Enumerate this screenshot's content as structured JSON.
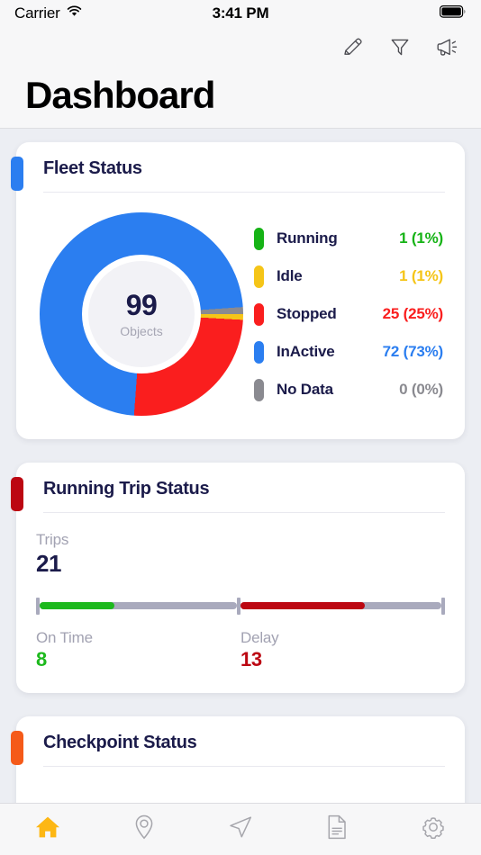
{
  "status_bar": {
    "carrier": "Carrier",
    "time": "3:41 PM",
    "wifi_icon": "wifi-icon",
    "battery_icon": "battery-full-icon"
  },
  "header": {
    "title": "Dashboard",
    "actions": [
      {
        "name": "edit-button",
        "icon": "pencil-icon"
      },
      {
        "name": "filter-button",
        "icon": "funnel-icon"
      },
      {
        "name": "announcement-button",
        "icon": "megaphone-icon"
      }
    ]
  },
  "cards": {
    "fleet": {
      "title": "Fleet Status",
      "accent_color": "#2b7ef0",
      "total": "99",
      "total_label": "Objects"
    },
    "trip": {
      "title": "Running Trip Status",
      "accent_color": "#bc0712",
      "trips_label": "Trips",
      "trips_value": "21",
      "on_time_label": "On Time",
      "on_time_value": "8",
      "on_time_color": "#1db91d",
      "delay_label": "Delay",
      "delay_value": "13",
      "delay_color": "#bc0712",
      "on_time_pct": 38,
      "delay_pct": 62
    },
    "checkpoint": {
      "title": "Checkpoint Status",
      "accent_color": "#f55a19"
    }
  },
  "tabbar": {
    "items": [
      {
        "name": "tab-home",
        "icon": "home-icon",
        "active": true,
        "color": "#fdb714"
      },
      {
        "name": "tab-location",
        "icon": "map-pin-icon",
        "active": false,
        "color": "#a6a6ac"
      },
      {
        "name": "tab-navigate",
        "icon": "navigation-arrow-icon",
        "active": false,
        "color": "#a6a6ac"
      },
      {
        "name": "tab-reports",
        "icon": "document-icon",
        "active": false,
        "color": "#a6a6ac"
      },
      {
        "name": "tab-settings",
        "icon": "gear-icon",
        "active": false,
        "color": "#a6a6ac"
      }
    ]
  },
  "chart_data": {
    "type": "pie",
    "title": "Fleet Status",
    "center_value": "99",
    "center_label": "Objects",
    "total": 99,
    "donut": true,
    "start_angle_deg": -4,
    "categories": [
      "Running",
      "Idle",
      "Stopped",
      "InActive",
      "No Data"
    ],
    "values": [
      1,
      1,
      25,
      72,
      0
    ],
    "percents": [
      1,
      1,
      25,
      73,
      0
    ],
    "colors": [
      "#16b316",
      "#f5c518",
      "#fa1e1e",
      "#2b7ef0",
      "#8a8a90"
    ],
    "legend_position": "right",
    "legend": [
      {
        "label": "Running",
        "value_text": "1 (1%)",
        "color": "#16b316",
        "count": 1,
        "percent": 1
      },
      {
        "label": "Idle",
        "value_text": "1 (1%)",
        "color": "#f5c518",
        "count": 1,
        "percent": 1
      },
      {
        "label": "Stopped",
        "value_text": "25 (25%)",
        "color": "#fa1e1e",
        "count": 25,
        "percent": 25
      },
      {
        "label": "InActive",
        "value_text": "72 (73%)",
        "color": "#2b7ef0",
        "count": 72,
        "percent": 73
      },
      {
        "label": "No Data",
        "value_text": "0 (0%)",
        "color": "#8a8a90",
        "count": 0,
        "percent": 0
      }
    ]
  }
}
